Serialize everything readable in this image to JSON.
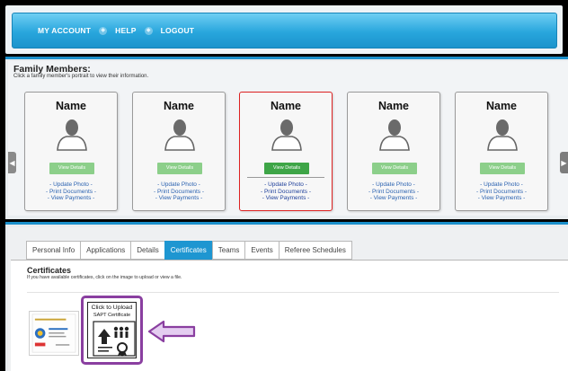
{
  "nav": {
    "items": [
      "MY ACCOUNT",
      "HELP",
      "LOGOUT"
    ]
  },
  "family": {
    "title": "Family Members:",
    "subtitle": "Click a family member's portrait to view their information.",
    "members": [
      {
        "name": "Name",
        "button": "View Details",
        "links": [
          "- Update Photo -",
          "- Print Documents -",
          "- View Payments -"
        ]
      },
      {
        "name": "Name",
        "button": "View Details",
        "links": [
          "- Update Photo -",
          "- Print Documents -",
          "- View Payments -"
        ]
      },
      {
        "name": "Name",
        "button": "View Details",
        "links": [
          "- Update Photo -",
          "- Print Documents -",
          "- View Payments -"
        ]
      },
      {
        "name": "Name",
        "button": "View Details",
        "links": [
          "- Update Photo -",
          "- Print Documents -",
          "- View Payments -"
        ]
      },
      {
        "name": "Name",
        "button": "View Details",
        "links": [
          "- Update Photo -",
          "- Print Documents -",
          "- View Payments -"
        ]
      }
    ]
  },
  "tabs": {
    "items": [
      "Personal Info",
      "Applications",
      "Details",
      "Certificates",
      "Teams",
      "Events",
      "Referee Schedules"
    ],
    "active": "Certificates"
  },
  "certificates": {
    "title": "Certificates",
    "subtitle": "If you have available certificates, click on the image to upload or view a file.",
    "upload_line1": "Click to Upload",
    "upload_line2": "SAPT Certificate"
  },
  "colors": {
    "nav_blue": "#28a6dd",
    "selected_border": "#dd2222",
    "highlight_purple": "#8a3fa0",
    "button_green": "#3ea547"
  }
}
